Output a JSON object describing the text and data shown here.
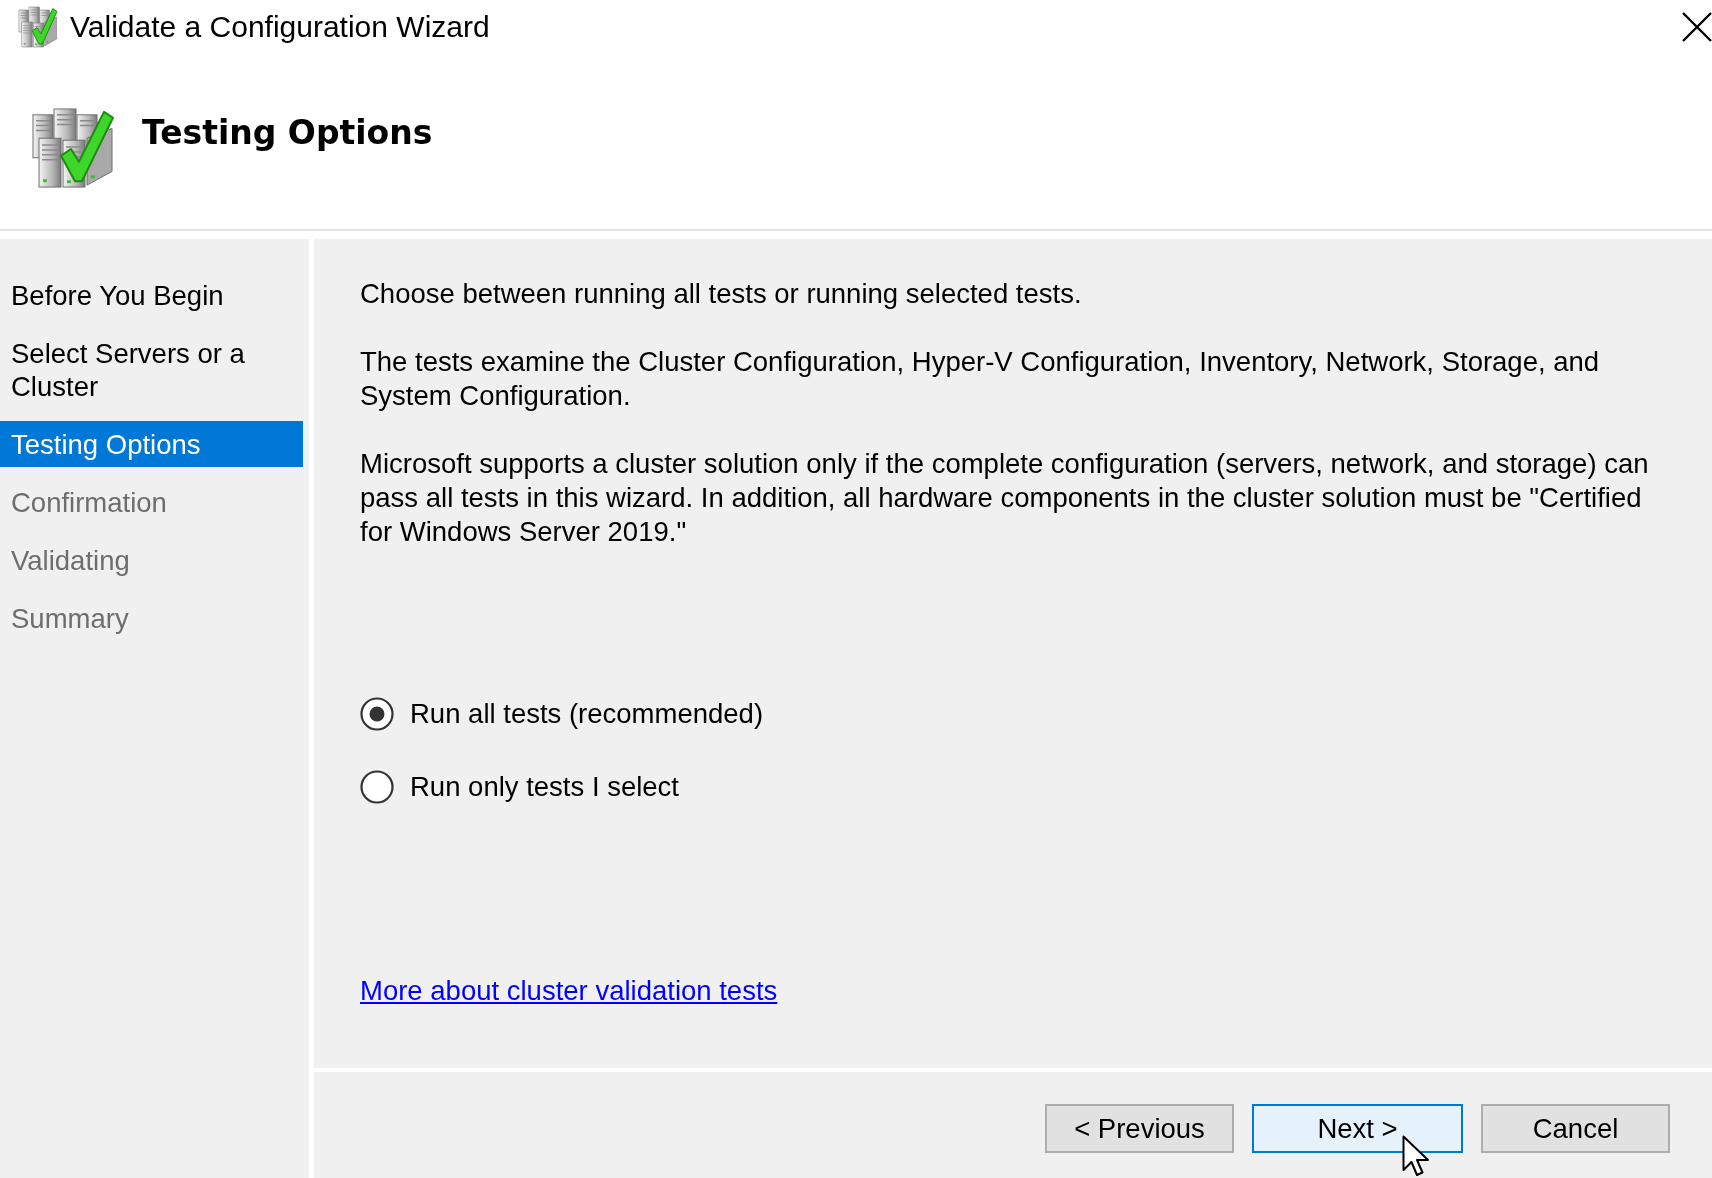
{
  "window": {
    "title": "Validate a Configuration Wizard"
  },
  "header": {
    "title": "Testing Options"
  },
  "steps": [
    {
      "label": "Before You Begin",
      "selected": false,
      "disabled": false
    },
    {
      "label": "Select Servers or a Cluster",
      "selected": false,
      "disabled": false
    },
    {
      "label": "Testing Options",
      "selected": true,
      "disabled": false
    },
    {
      "label": "Confirmation",
      "selected": false,
      "disabled": true
    },
    {
      "label": "Validating",
      "selected": false,
      "disabled": true
    },
    {
      "label": "Summary",
      "selected": false,
      "disabled": true
    }
  ],
  "content": {
    "paragraphs": [
      "Choose between running all tests or running selected tests.",
      "The tests examine the Cluster Configuration, Hyper-V Configuration, Inventory, Network, Storage, and System Configuration.",
      "Microsoft supports a cluster solution only if the complete configuration (servers, network, and storage) can pass all tests in this wizard. In addition, all hardware components in the cluster solution must be \"Certified for Windows Server 2019.\""
    ],
    "options": [
      {
        "label": "Run all tests (recommended)",
        "selected": true
      },
      {
        "label": "Run only tests I select",
        "selected": false
      }
    ],
    "link": "More about cluster validation tests"
  },
  "buttons": [
    {
      "label": "< Previous",
      "default": false
    },
    {
      "label": "Next >",
      "default": true
    },
    {
      "label": "Cancel",
      "default": false
    }
  ]
}
